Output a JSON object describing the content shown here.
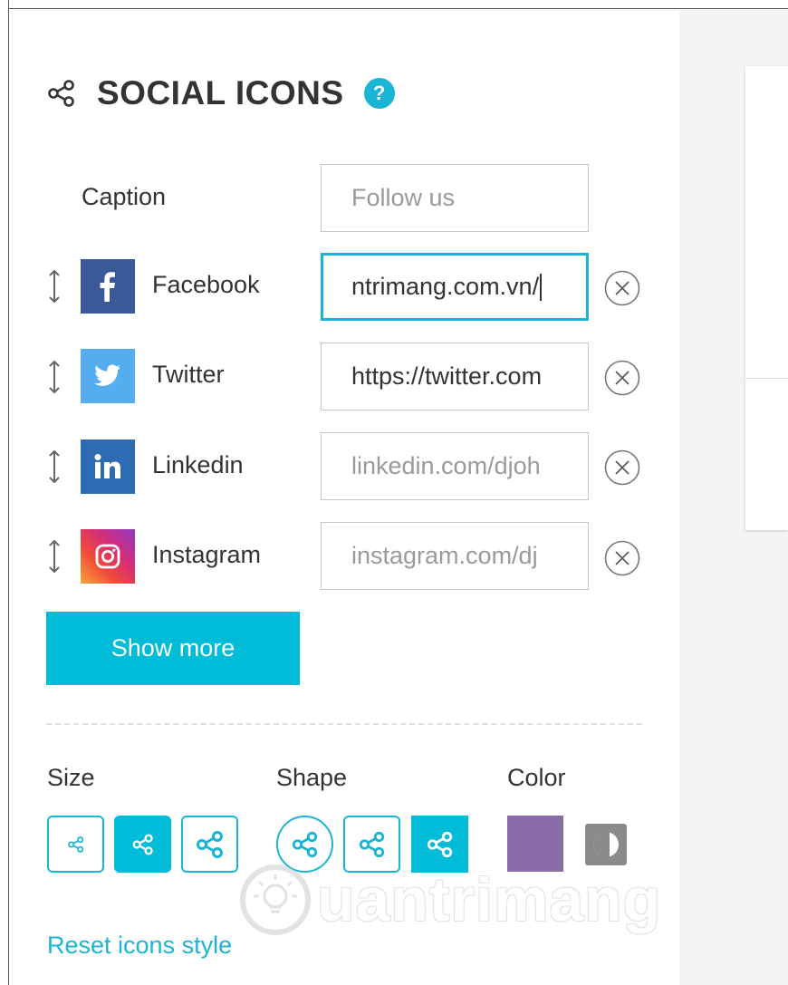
{
  "header": {
    "title": "SOCIAL ICONS",
    "help_glyph": "?"
  },
  "caption": {
    "label": "Caption",
    "placeholder": "Follow us"
  },
  "networks": [
    {
      "name": "Facebook",
      "icon": "facebook-icon",
      "value": "ntrimang.com.vn/",
      "placeholder": ""
    },
    {
      "name": "Twitter",
      "icon": "twitter-icon",
      "value": "https://twitter.com",
      "placeholder": ""
    },
    {
      "name": "Linkedin",
      "icon": "linkedin-icon",
      "value": "",
      "placeholder": "linkedin.com/djoh"
    },
    {
      "name": "Instagram",
      "icon": "instagram-icon",
      "value": "",
      "placeholder": "instagram.com/dj"
    }
  ],
  "show_more": "Show more",
  "options": {
    "size_label": "Size",
    "shape_label": "Shape",
    "color_label": "Color",
    "selected_color": "#8a6da8"
  },
  "reset_label": "Reset icons style",
  "watermark": "uantrimang",
  "colors": {
    "accent": "#00bcd9",
    "facebook": "#3b5998",
    "twitter": "#55acee",
    "linkedin": "#2d6cb3"
  }
}
